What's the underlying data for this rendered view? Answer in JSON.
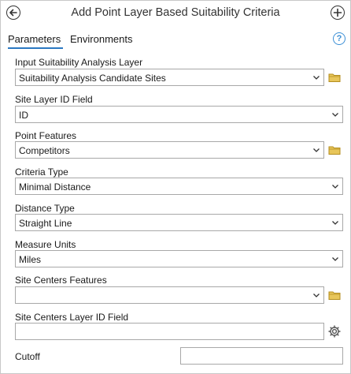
{
  "header": {
    "title": "Add Point Layer Based Suitability Criteria"
  },
  "tabs": [
    {
      "label": "Parameters"
    },
    {
      "label": "Environments"
    }
  ],
  "help_glyph": "?",
  "fields": {
    "input_layer": {
      "label": "Input Suitability Analysis Layer",
      "value": "Suitability Analysis Candidate Sites"
    },
    "site_id_field": {
      "label": "Site Layer ID Field",
      "value": "ID"
    },
    "point_features": {
      "label": "Point Features",
      "value": "Competitors"
    },
    "criteria_type": {
      "label": "Criteria Type",
      "value": "Minimal Distance"
    },
    "distance_type": {
      "label": "Distance Type",
      "value": "Straight Line"
    },
    "measure_units": {
      "label": "Measure Units",
      "value": "Miles"
    },
    "site_centers_features": {
      "label": "Site Centers Features",
      "value": ""
    },
    "site_centers_id_field": {
      "label": "Site Centers Layer ID Field",
      "value": ""
    },
    "cutoff": {
      "label": "Cutoff",
      "value": ""
    }
  },
  "icons": {
    "back": "back-arrow-icon",
    "add": "plus-icon",
    "help": "help-icon",
    "folder": "folder-icon",
    "gear": "gear-icon",
    "chevron": "chevron-down-icon"
  },
  "colors": {
    "accent": "#2b78c2",
    "help": "#3b8fd6",
    "folder": "#d8b23a"
  }
}
